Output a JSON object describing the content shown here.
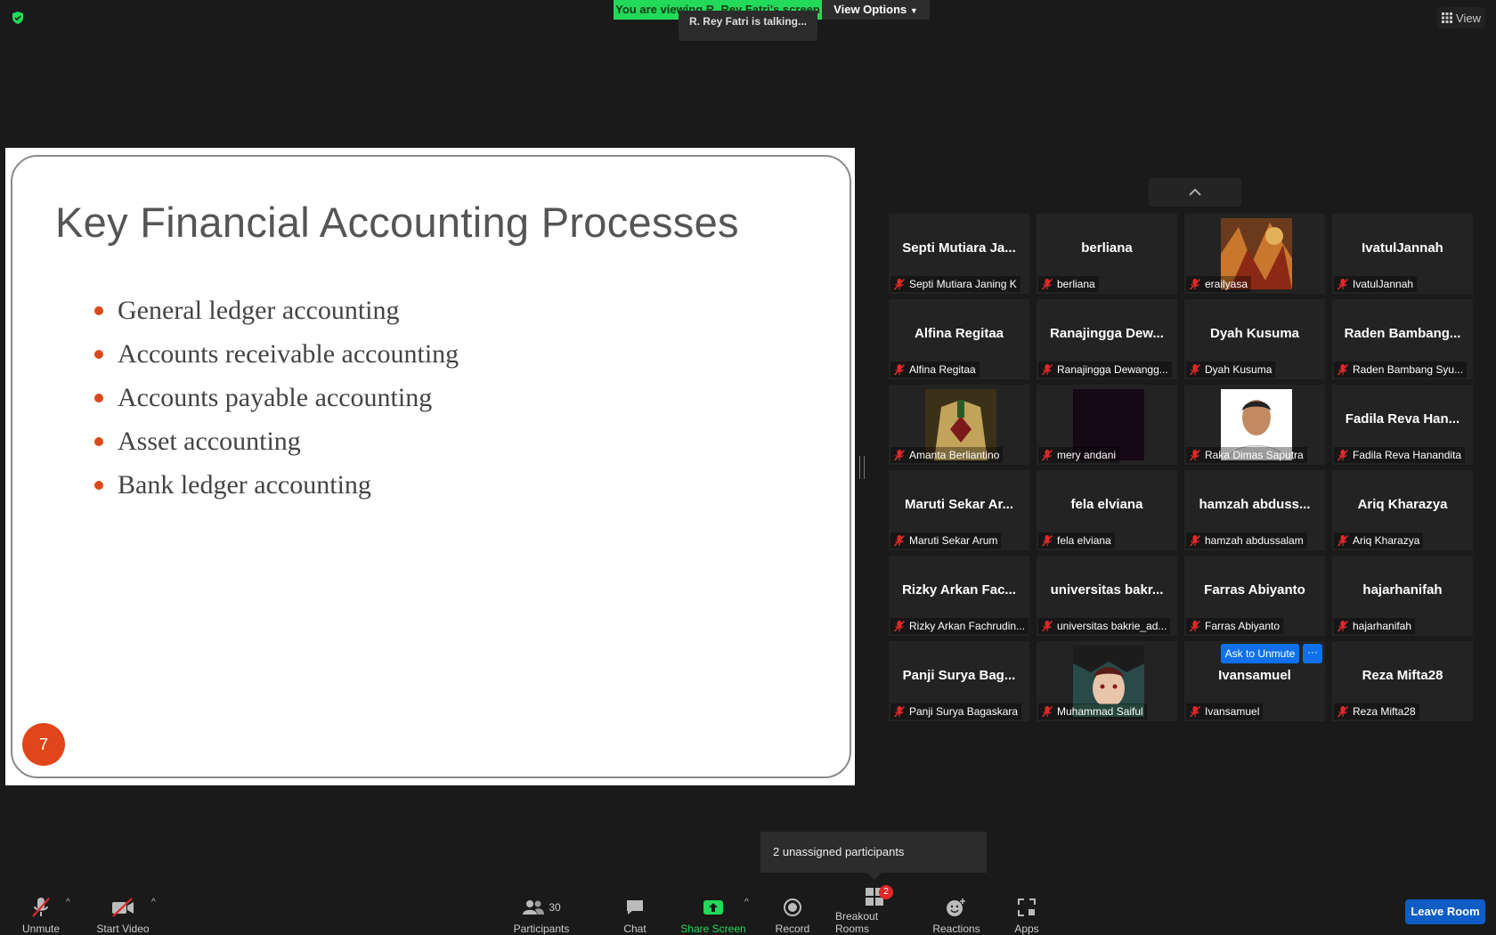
{
  "top": {
    "viewing_banner": "You are viewing R. Rey Fatri's screen",
    "view_options": "View Options",
    "talking": "R. Rey Fatri is talking...",
    "view_button": "View"
  },
  "slide": {
    "title": "Key Financial Accounting Processes",
    "bullets": [
      "General ledger accounting",
      "Accounts receivable accounting",
      "Accounts payable accounting",
      "Asset accounting",
      "Bank ledger accounting"
    ],
    "page_number": "7"
  },
  "participants": [
    {
      "big": "Septi Mutiara Ja...",
      "name": "Septi Mutiara Janing K"
    },
    {
      "big": "berliana",
      "name": "berliana"
    },
    {
      "big": "",
      "name": "erailyasa",
      "photo": "painting"
    },
    {
      "big": "IvatulJannah",
      "name": "IvatulJannah"
    },
    {
      "big": "Alfina Regitaa",
      "name": "Alfina Regitaa"
    },
    {
      "big": "Ranajingga Dew...",
      "name": "Ranajingga Dewangg..."
    },
    {
      "big": "Dyah Kusuma",
      "name": "Dyah Kusuma"
    },
    {
      "big": "Raden Bambang...",
      "name": "Raden Bambang Syu..."
    },
    {
      "big": "",
      "name": "Amanta Berliantino",
      "photo": "jacket"
    },
    {
      "big": "",
      "name": "mery andani",
      "photo": "dark"
    },
    {
      "big": "",
      "name": "Raka Dimas Saputra",
      "photo": "portrait"
    },
    {
      "big": "Fadila Reva Han...",
      "name": "Fadila Reva Hanandita"
    },
    {
      "big": "Maruti Sekar Ar...",
      "name": "Maruti Sekar Arum"
    },
    {
      "big": "fela elviana",
      "name": "fela elviana"
    },
    {
      "big": "hamzah abduss...",
      "name": "hamzah abdussalam"
    },
    {
      "big": "Ariq Kharazya",
      "name": "Ariq Kharazya"
    },
    {
      "big": "Rizky Arkan Fac...",
      "name": "Rizky Arkan Fachrudin..."
    },
    {
      "big": "universitas bakr...",
      "name": "universitas bakrie_ad..."
    },
    {
      "big": "Farras Abiyanto",
      "name": "Farras Abiyanto"
    },
    {
      "big": "hajarhanifah",
      "name": "hajarhanifah"
    },
    {
      "big": "Panji Surya Bag...",
      "name": "Panji Surya Bagaskara"
    },
    {
      "big": "",
      "name": "Muhammad Saiful",
      "photo": "anime"
    },
    {
      "big": "Ivansamuel",
      "name": "Ivansamuel"
    },
    {
      "big": "Reza Mifta28",
      "name": "Reza Mifta28"
    }
  ],
  "ask_to_unmute": "Ask to Unmute",
  "ask_more": "···",
  "tooltip": "2 unassigned participants",
  "toolbar": {
    "unmute": "Unmute",
    "start_video": "Start Video",
    "participants": "Participants",
    "participants_count": "30",
    "chat": "Chat",
    "share_screen": "Share Screen",
    "record": "Record",
    "breakout_rooms": "Breakout Rooms",
    "breakout_badge": "2",
    "reactions": "Reactions",
    "apps": "Apps",
    "leave_room": "Leave Room"
  },
  "colors": {
    "banner_green": "#23d959",
    "accent_blue": "#0e71eb",
    "bullet_orange": "#d84a1b",
    "mute_red": "#e02828"
  }
}
